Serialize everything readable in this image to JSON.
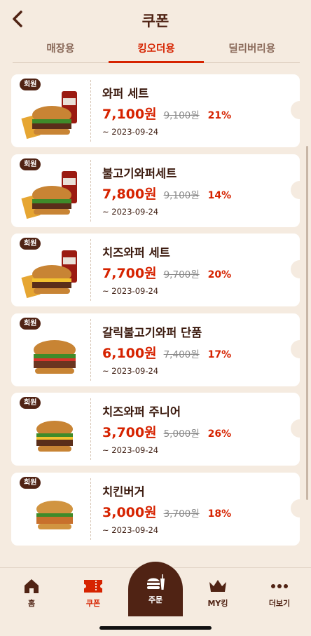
{
  "header": {
    "title": "쿠폰",
    "back_icon": "chevron-left-icon"
  },
  "tabs": [
    {
      "label": "매장용",
      "active": false
    },
    {
      "label": "킹오더용",
      "active": true
    },
    {
      "label": "딜리버리용",
      "active": false
    }
  ],
  "coupons": [
    {
      "badge": "회원",
      "name": "와퍼 세트",
      "price": "7,100원",
      "original": "9,100원",
      "discount": "21%",
      "expiry": "~ 2023-09-24",
      "image": "burger-set-image"
    },
    {
      "badge": "회원",
      "name": "불고기와퍼세트",
      "price": "7,800원",
      "original": "9,100원",
      "discount": "14%",
      "expiry": "~ 2023-09-24",
      "image": "burger-set-image"
    },
    {
      "badge": "회원",
      "name": "치즈와퍼 세트",
      "price": "7,700원",
      "original": "9,700원",
      "discount": "20%",
      "expiry": "~ 2023-09-24",
      "image": "burger-set-image"
    },
    {
      "badge": "회원",
      "name": "갈릭불고기와퍼 단품",
      "price": "6,100원",
      "original": "7,400원",
      "discount": "17%",
      "expiry": "~ 2023-09-24",
      "image": "burger-image"
    },
    {
      "badge": "회원",
      "name": "치즈와퍼 주니어",
      "price": "3,700원",
      "original": "5,000원",
      "discount": "26%",
      "expiry": "~ 2023-09-24",
      "image": "burger-image"
    },
    {
      "badge": "회원",
      "name": "치킨버거",
      "price": "3,000원",
      "original": "3,700원",
      "discount": "18%",
      "expiry": "~ 2023-09-24",
      "image": "burger-image"
    }
  ],
  "bottom_nav": {
    "home": "홈",
    "coupon": "쿠폰",
    "order": "주문",
    "my_king": "MY킹",
    "more": "더보기"
  },
  "colors": {
    "brand_brown": "#502314",
    "accent_red": "#d62300",
    "background": "#f5ebe0"
  }
}
